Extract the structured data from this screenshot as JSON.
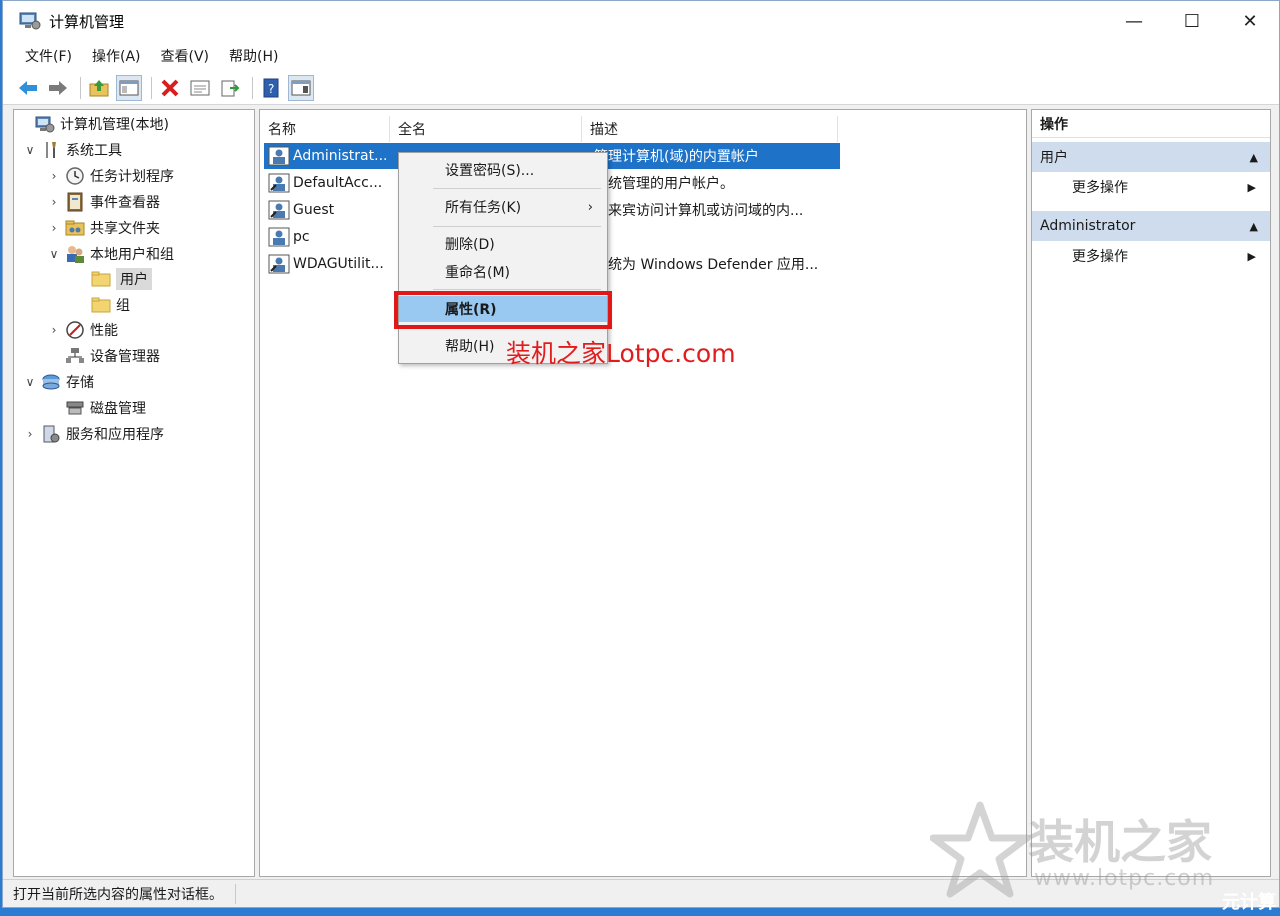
{
  "window": {
    "title": "计算机管理",
    "controls": {
      "minimize": "—",
      "maximize": "☐",
      "close": "✕"
    }
  },
  "menu": [
    "文件(F)",
    "操作(A)",
    "查看(V)",
    "帮助(H)"
  ],
  "toolbar_icons": [
    "back-icon",
    "forward-icon",
    "up-folder-icon",
    "show-tree-icon",
    "delete-icon",
    "properties-icon",
    "export-icon",
    "help-icon",
    "show-action-pane-icon"
  ],
  "tree": [
    {
      "label": "计算机管理(本地)",
      "toggle": "",
      "icon": "computer-management-icon"
    },
    {
      "label": "系统工具",
      "toggle": "∨",
      "icon": "system-tools-icon"
    },
    {
      "label": "任务计划程序",
      "toggle": "›",
      "icon": "task-scheduler-icon"
    },
    {
      "label": "事件查看器",
      "toggle": "›",
      "icon": "event-viewer-icon"
    },
    {
      "label": "共享文件夹",
      "toggle": "›",
      "icon": "shared-folders-icon"
    },
    {
      "label": "本地用户和组",
      "toggle": "∨",
      "icon": "local-users-groups-icon"
    },
    {
      "label": "用户",
      "toggle": "",
      "icon": "folder-icon"
    },
    {
      "label": "组",
      "toggle": "",
      "icon": "folder-icon"
    },
    {
      "label": "性能",
      "toggle": "›",
      "icon": "performance-icon"
    },
    {
      "label": "设备管理器",
      "toggle": "",
      "icon": "device-manager-icon"
    },
    {
      "label": "存储",
      "toggle": "∨",
      "icon": "storage-icon"
    },
    {
      "label": "磁盘管理",
      "toggle": "",
      "icon": "disk-management-icon"
    },
    {
      "label": "服务和应用程序",
      "toggle": "›",
      "icon": "services-apps-icon"
    }
  ],
  "columns": [
    "名称",
    "全名",
    "描述"
  ],
  "rows": [
    {
      "name": "Administrat...",
      "desc": "管理计算机(域)的内置帐户"
    },
    {
      "name": "DefaultAcc...",
      "desc": "系统管理的用户帐户。"
    },
    {
      "name": "Guest",
      "desc": "供来宾访问计算机或访问域的内..."
    },
    {
      "name": "pc",
      "desc": ""
    },
    {
      "name": "WDAGUtilit...",
      "desc": "系统为 Windows Defender 应用..."
    }
  ],
  "context_menu": {
    "set_password": "设置密码(S)...",
    "all_tasks": "所有任务(K)",
    "all_tasks_arrow": "›",
    "delete": "删除(D)",
    "rename": "重命名(M)",
    "properties": "属性(R)",
    "help": "帮助(H)"
  },
  "actions": {
    "header": "操作",
    "sections": [
      {
        "title": "用户",
        "item": "更多操作"
      },
      {
        "title": "Administrator",
        "item": "更多操作"
      }
    ],
    "collapse_glyph": "▲",
    "more_glyph": "▶"
  },
  "status": "打开当前所选内容的属性对话框。",
  "watermarks": {
    "red_text": "装机之家Lotpc.com",
    "logo_cn": "装机之家",
    "logo_url": "www.lotpc.com",
    "corner": "元计算"
  },
  "colors": {
    "selection": "#1e73c8",
    "highlight_box": "#e01818",
    "menu_hover": "#99c8f0",
    "section_bg": "#cfdced"
  }
}
